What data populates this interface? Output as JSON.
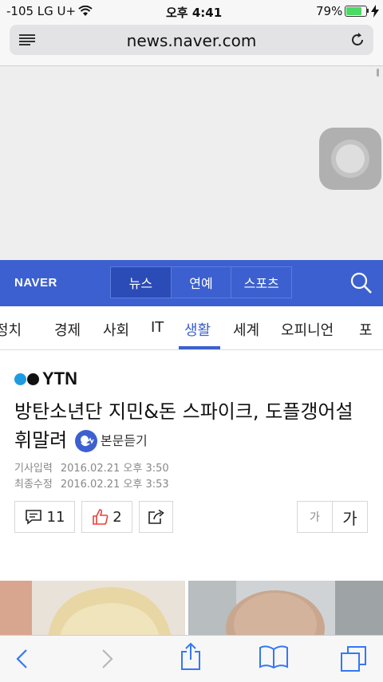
{
  "status": {
    "carrier": "-105 LG U+",
    "time": "오후 4:41",
    "battery": "79%"
  },
  "browser": {
    "url": "news.naver.com"
  },
  "naver": {
    "logo": "NAVER",
    "tabs": [
      {
        "label": "뉴스"
      },
      {
        "label": "연예"
      },
      {
        "label": "스포츠"
      }
    ],
    "categories": [
      "정치",
      "경제",
      "사회",
      "IT",
      "생활",
      "세계",
      "오피니언",
      "포"
    ]
  },
  "article": {
    "source": "YTN",
    "headline": "방탄소년단 지민&돈 스파이크, 도플갱어설 휘말려",
    "listen_label": "본문듣기",
    "input_label": "기사입력",
    "input_date": "2016.02.21 오후 3:50",
    "modified_label": "최종수정",
    "modified_date": "2016.02.21 오후 3:53",
    "comments": "11",
    "likes": "2",
    "font_small": "가",
    "font_large": "가"
  },
  "colors": {
    "naver_blue": "#3c60cf",
    "like_red": "#e8413c"
  }
}
